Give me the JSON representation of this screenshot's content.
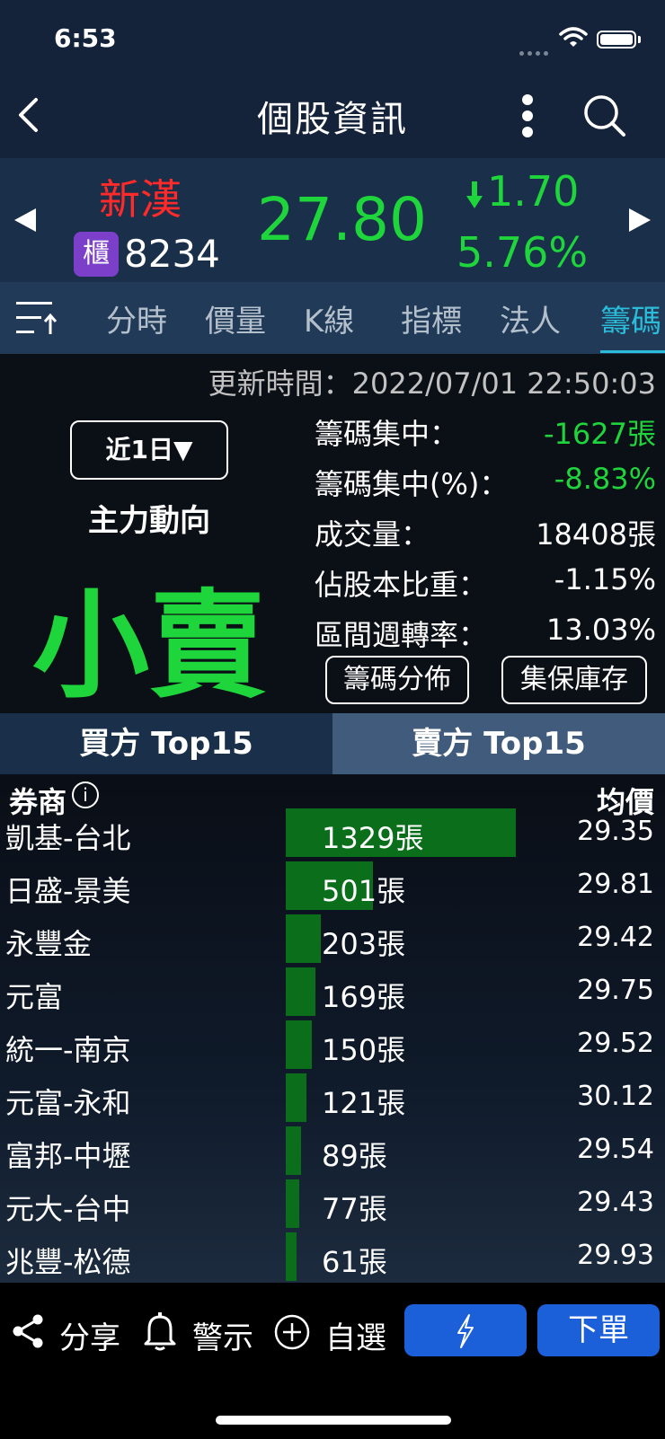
{
  "status_bar": {
    "time": "6:53"
  },
  "nav": {
    "title": "個股資訊",
    "back_icon": "chevron-left-icon",
    "more_icon": "more-vertical-icon",
    "search_icon": "search-icon"
  },
  "stock": {
    "name": "新漢",
    "market_badge": "櫃",
    "code": "8234",
    "price": "27.80",
    "change": "1.70",
    "change_pct": "5.76%",
    "name_color": "#ff2a2a",
    "down_color": "#1fd53c"
  },
  "tabs": [
    "分時",
    "價量",
    "K線",
    "指標",
    "法人",
    "籌碼"
  ],
  "active_tab": "籌碼",
  "info": {
    "update_time": "更新時間：2022/07/01 22:50:03",
    "period": "近1日▼",
    "main_force_label": "主力動向",
    "main_force_value": "小賣",
    "stats": [
      {
        "label": "籌碼集中：",
        "value": "-1627張",
        "color": "#1fd53c"
      },
      {
        "label": "籌碼集中(%)：",
        "value": "-8.83%",
        "color": "#1fd53c"
      },
      {
        "label": "成交量：",
        "value": "18408張",
        "color": "#ffffff"
      },
      {
        "label": "佔股本比重：",
        "value": "-1.15%",
        "color": "#ffffff"
      },
      {
        "label": "區間週轉率：",
        "value": "13.03%",
        "color": "#ffffff"
      }
    ],
    "buttons": {
      "distribution": "籌碼分佈",
      "custody": "集保庫存"
    }
  },
  "buy_sell_tabs": {
    "buy": "買方 Top15",
    "sell": "賣方 Top15",
    "active": "sell"
  },
  "table": {
    "header_broker": "券商",
    "header_price": "均價",
    "rows": [
      {
        "broker": "凱基-台北",
        "qty": "1329張",
        "lots": 1329,
        "price": "29.35"
      },
      {
        "broker": "日盛-景美",
        "qty": "501張",
        "lots": 501,
        "price": "29.81"
      },
      {
        "broker": "永豐金",
        "qty": "203張",
        "lots": 203,
        "price": "29.42"
      },
      {
        "broker": "元富",
        "qty": "169張",
        "lots": 169,
        "price": "29.75"
      },
      {
        "broker": "統一-南京",
        "qty": "150張",
        "lots": 150,
        "price": "29.52"
      },
      {
        "broker": "元富-永和",
        "qty": "121張",
        "lots": 121,
        "price": "30.12"
      },
      {
        "broker": "富邦-中壢",
        "qty": "89張",
        "lots": 89,
        "price": "29.54"
      },
      {
        "broker": "元大-台中",
        "qty": "77張",
        "lots": 77,
        "price": "29.43"
      },
      {
        "broker": "兆豐-松德",
        "qty": "61張",
        "lots": 61,
        "price": "29.93"
      }
    ]
  },
  "bottom_bar": {
    "share": "分享",
    "alert": "警示",
    "watchlist": "自選",
    "order": "下單",
    "accent": "#1b60d8"
  }
}
